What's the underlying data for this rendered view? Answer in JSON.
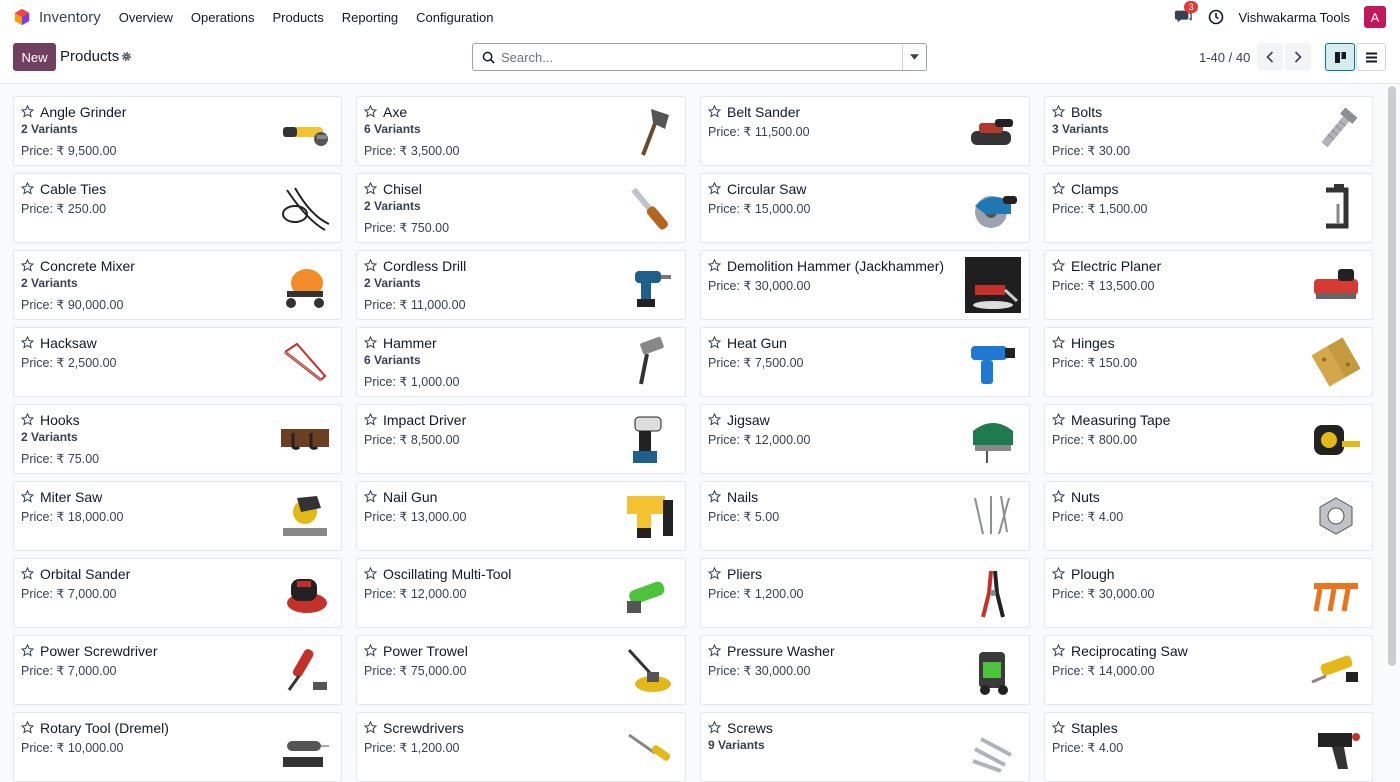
{
  "navbar": {
    "app_name": "Inventory",
    "menu": [
      "Overview",
      "Operations",
      "Products",
      "Reporting",
      "Configuration"
    ],
    "messages_badge": "3",
    "company": "Vishwakarma Tools",
    "avatar_letter": "A",
    "icons": [
      "app-logo-icon",
      "chat-icon",
      "clock-icon"
    ]
  },
  "control": {
    "new_label": "New",
    "title": "Products",
    "search_placeholder": "Search...",
    "pager": "1-40 / 40",
    "views": [
      "kanban",
      "list"
    ]
  },
  "colors": {
    "brand": "#71405e",
    "accent": "#017e84",
    "badge": "#e53935"
  },
  "products": [
    {
      "name": "Angle Grinder",
      "variants": "2 Variants",
      "price": "Price: ₹ 9,500.00",
      "icon": "angle-grinder-icon"
    },
    {
      "name": "Axe",
      "variants": "6 Variants",
      "price": "Price: ₹ 3,500.00",
      "icon": "axe-icon"
    },
    {
      "name": "Belt Sander",
      "variants": "",
      "price": "Price: ₹ 11,500.00",
      "icon": "belt-sander-icon"
    },
    {
      "name": "Bolts",
      "variants": "3 Variants",
      "price": "Price: ₹ 30.00",
      "icon": "bolt-icon"
    },
    {
      "name": "Cable Ties",
      "variants": "",
      "price": "Price: ₹ 250.00",
      "icon": "cable-ties-icon"
    },
    {
      "name": "Chisel",
      "variants": "2 Variants",
      "price": "Price: ₹ 750.00",
      "icon": "chisel-icon"
    },
    {
      "name": "Circular Saw",
      "variants": "",
      "price": "Price: ₹ 15,000.00",
      "icon": "circular-saw-icon"
    },
    {
      "name": "Clamps",
      "variants": "",
      "price": "Price: ₹ 1,500.00",
      "icon": "clamp-icon"
    },
    {
      "name": "Concrete Mixer",
      "variants": "2 Variants",
      "price": "Price: ₹ 90,000.00",
      "icon": "concrete-mixer-icon"
    },
    {
      "name": "Cordless Drill",
      "variants": "2 Variants",
      "price": "Price: ₹ 11,000.00",
      "icon": "drill-icon"
    },
    {
      "name": "Demolition Hammer (Jackhammer)",
      "variants": "",
      "price": "Price: ₹ 30,000.00",
      "icon": "jackhammer-icon"
    },
    {
      "name": "Electric Planer",
      "variants": "",
      "price": "Price: ₹ 13,500.00",
      "icon": "planer-icon"
    },
    {
      "name": "Hacksaw",
      "variants": "",
      "price": "Price: ₹ 2,500.00",
      "icon": "hacksaw-icon"
    },
    {
      "name": "Hammer",
      "variants": "6 Variants",
      "price": "Price: ₹ 1,000.00",
      "icon": "hammer-icon"
    },
    {
      "name": "Heat Gun",
      "variants": "",
      "price": "Price: ₹ 7,500.00",
      "icon": "heat-gun-icon"
    },
    {
      "name": "Hinges",
      "variants": "",
      "price": "Price: ₹ 150.00",
      "icon": "hinge-icon"
    },
    {
      "name": "Hooks",
      "variants": "2 Variants",
      "price": "Price: ₹ 75.00",
      "icon": "hooks-icon"
    },
    {
      "name": "Impact Driver",
      "variants": "",
      "price": "Price: ₹ 8,500.00",
      "icon": "impact-driver-icon"
    },
    {
      "name": "Jigsaw",
      "variants": "",
      "price": "Price: ₹ 12,000.00",
      "icon": "jigsaw-icon"
    },
    {
      "name": "Measuring Tape",
      "variants": "",
      "price": "Price: ₹ 800.00",
      "icon": "measuring-tape-icon"
    },
    {
      "name": "Miter Saw",
      "variants": "",
      "price": "Price: ₹ 18,000.00",
      "icon": "miter-saw-icon"
    },
    {
      "name": "Nail Gun",
      "variants": "",
      "price": "Price: ₹ 13,000.00",
      "icon": "nail-gun-icon"
    },
    {
      "name": "Nails",
      "variants": "",
      "price": "Price: ₹ 5.00",
      "icon": "nails-icon"
    },
    {
      "name": "Nuts",
      "variants": "",
      "price": "Price: ₹ 4.00",
      "icon": "nut-icon"
    },
    {
      "name": "Orbital Sander",
      "variants": "",
      "price": "Price: ₹ 7,000.00",
      "icon": "orbital-sander-icon"
    },
    {
      "name": "Oscillating Multi-Tool",
      "variants": "",
      "price": "Price: ₹ 12,000.00",
      "icon": "multi-tool-icon"
    },
    {
      "name": "Pliers",
      "variants": "",
      "price": "Price: ₹ 1,200.00",
      "icon": "pliers-icon"
    },
    {
      "name": "Plough",
      "variants": "",
      "price": "Price: ₹ 30,000.00",
      "icon": "plough-icon"
    },
    {
      "name": "Power Screwdriver",
      "variants": "",
      "price": "Price: ₹ 7,000.00",
      "icon": "power-screwdriver-icon"
    },
    {
      "name": "Power Trowel",
      "variants": "",
      "price": "Price: ₹ 75,000.00",
      "icon": "power-trowel-icon"
    },
    {
      "name": "Pressure Washer",
      "variants": "",
      "price": "Price: ₹ 30,000.00",
      "icon": "pressure-washer-icon"
    },
    {
      "name": "Reciprocating Saw",
      "variants": "",
      "price": "Price: ₹ 14,000.00",
      "icon": "reciprocating-saw-icon"
    },
    {
      "name": "Rotary Tool (Dremel)",
      "variants": "",
      "price": "Price: ₹ 10,000.00",
      "icon": "rotary-tool-icon"
    },
    {
      "name": "Screwdrivers",
      "variants": "",
      "price": "Price: ₹ 1,200.00",
      "icon": "screwdriver-icon"
    },
    {
      "name": "Screws",
      "variants": "9 Variants",
      "price": "",
      "icon": "screws-icon"
    },
    {
      "name": "Staples",
      "variants": "",
      "price": "Price: ₹ 4.00",
      "icon": "staple-gun-icon"
    }
  ]
}
